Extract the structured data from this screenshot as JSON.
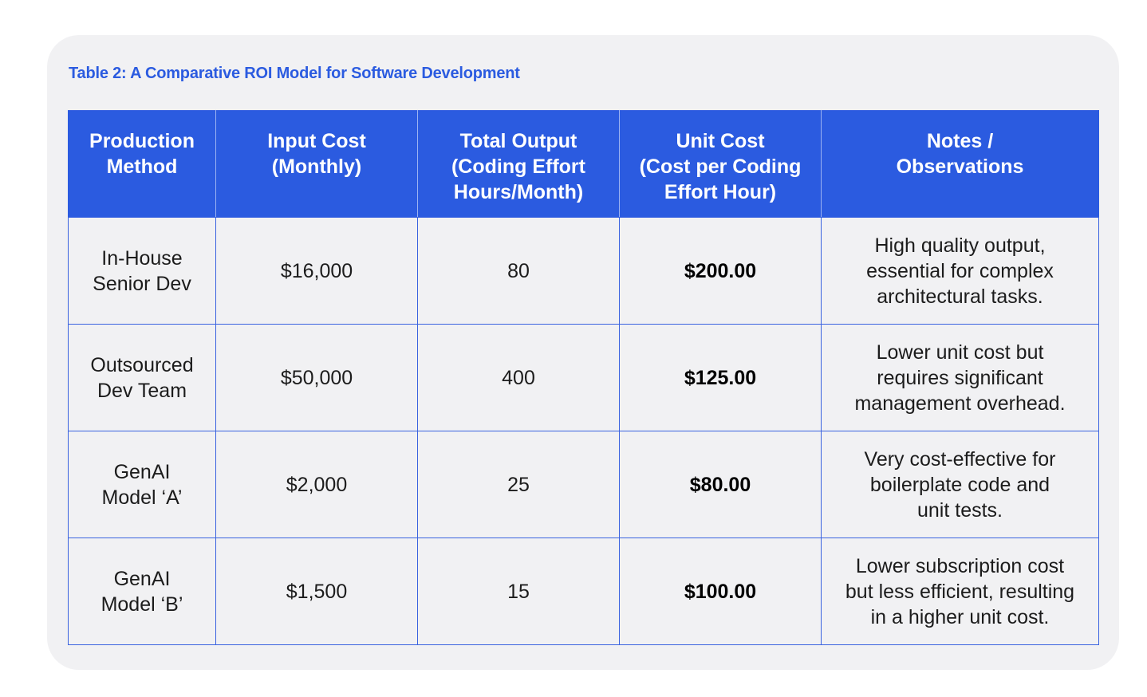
{
  "caption": "Table 2: A Comparative ROI Model for Software Development",
  "headers": [
    [
      "Production",
      "Method"
    ],
    [
      "Input Cost",
      "(Monthly)"
    ],
    [
      "Total Output",
      "(Coding Effort",
      "Hours/Month)"
    ],
    [
      "Unit Cost",
      "(Cost per Coding",
      "Effort Hour)"
    ],
    [
      "Notes /",
      "Observations"
    ]
  ],
  "rows": [
    {
      "method": [
        "In-House",
        "Senior Dev"
      ],
      "input_cost": "$16,000",
      "output": "80",
      "unit_cost": "$200.00",
      "notes": [
        "High quality output,",
        "essential for complex",
        "architectural tasks."
      ]
    },
    {
      "method": [
        "Outsourced",
        "Dev Team"
      ],
      "input_cost": "$50,000",
      "output": "400",
      "unit_cost": "$125.00",
      "notes": [
        "Lower unit cost but",
        "requires significant",
        "management overhead."
      ]
    },
    {
      "method": [
        "GenAI",
        "Model ‘A’"
      ],
      "input_cost": "$2,000",
      "output": "25",
      "unit_cost": "$80.00",
      "notes": [
        "Very cost-effective for",
        "boilerplate code and",
        "unit tests."
      ]
    },
    {
      "method": [
        "GenAI",
        "Model ‘B’"
      ],
      "input_cost": "$1,500",
      "output": "15",
      "unit_cost": "$100.00",
      "notes": [
        "Lower subscription cost",
        "but less efficient, resulting",
        "in a higher unit cost."
      ]
    }
  ],
  "colors": {
    "accent": "#2b5be0",
    "card_background": "#f1f1f3",
    "header_text": "#ffffff"
  }
}
